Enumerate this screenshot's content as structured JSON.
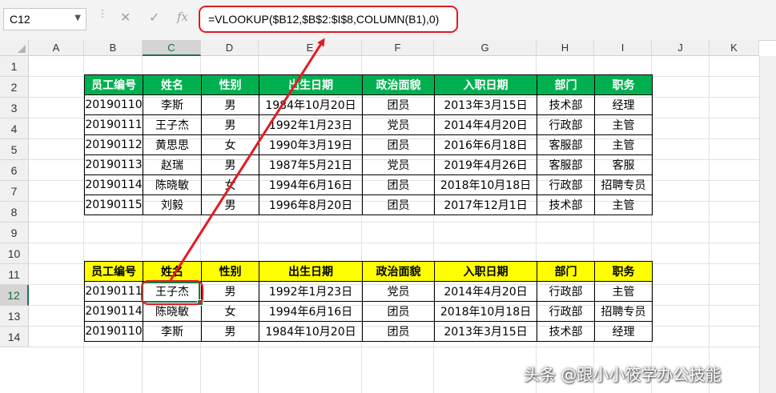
{
  "formula_bar": {
    "name_box": "C12",
    "cancel_icon": "✕",
    "enter_icon": "✓",
    "fx_icon": "fx",
    "formula": "=VLOOKUP($B12,$B$2:$I$8,COLUMN(B1),0)"
  },
  "columns": [
    "A",
    "B",
    "C",
    "D",
    "E",
    "F",
    "G",
    "H",
    "I",
    "J",
    "K"
  ],
  "rows": [
    "1",
    "2",
    "3",
    "4",
    "5",
    "6",
    "7",
    "8",
    "9",
    "10",
    "11",
    "12",
    "13",
    "14"
  ],
  "selected_cell": "C12",
  "table1": {
    "headers": [
      "员工编号",
      "姓名",
      "性别",
      "出生日期",
      "政治面貌",
      "入职日期",
      "部门",
      "职务"
    ],
    "header_color": "#00b050",
    "rows": [
      [
        "20190110",
        "李斯",
        "男",
        "1984年10月20日",
        "团员",
        "2013年3月15日",
        "技术部",
        "经理"
      ],
      [
        "20190111",
        "王子杰",
        "男",
        "1992年1月23日",
        "党员",
        "2014年4月20日",
        "行政部",
        "主管"
      ],
      [
        "20190112",
        "黄思思",
        "女",
        "1990年3月19日",
        "团员",
        "2016年6月18日",
        "客服部",
        "主管"
      ],
      [
        "20190113",
        "赵瑞",
        "男",
        "1987年5月21日",
        "党员",
        "2019年4月26日",
        "客服部",
        "客服"
      ],
      [
        "20190114",
        "陈晓敏",
        "女",
        "1994年6月16日",
        "团员",
        "2018年10月18日",
        "行政部",
        "招聘专员"
      ],
      [
        "20190115",
        "刘毅",
        "男",
        "1996年8月20日",
        "团员",
        "2017年12月1日",
        "技术部",
        "主管"
      ]
    ]
  },
  "table2": {
    "headers": [
      "员工编号",
      "姓名",
      "性别",
      "出生日期",
      "政治面貌",
      "入职日期",
      "部门",
      "职务"
    ],
    "header_color": "#ffff00",
    "rows": [
      [
        "20190111",
        "王子杰",
        "男",
        "1992年1月23日",
        "党员",
        "2014年4月20日",
        "行政部",
        "主管"
      ],
      [
        "20190114",
        "陈晓敏",
        "女",
        "1994年6月16日",
        "团员",
        "2018年10月18日",
        "行政部",
        "招聘专员"
      ],
      [
        "20190110",
        "李斯",
        "男",
        "1984年10月20日",
        "团员",
        "2013年3月15日",
        "技术部",
        "经理"
      ]
    ]
  },
  "annotation_color": "#e11a22",
  "watermark": "头条 @跟小小筱学办公技能"
}
